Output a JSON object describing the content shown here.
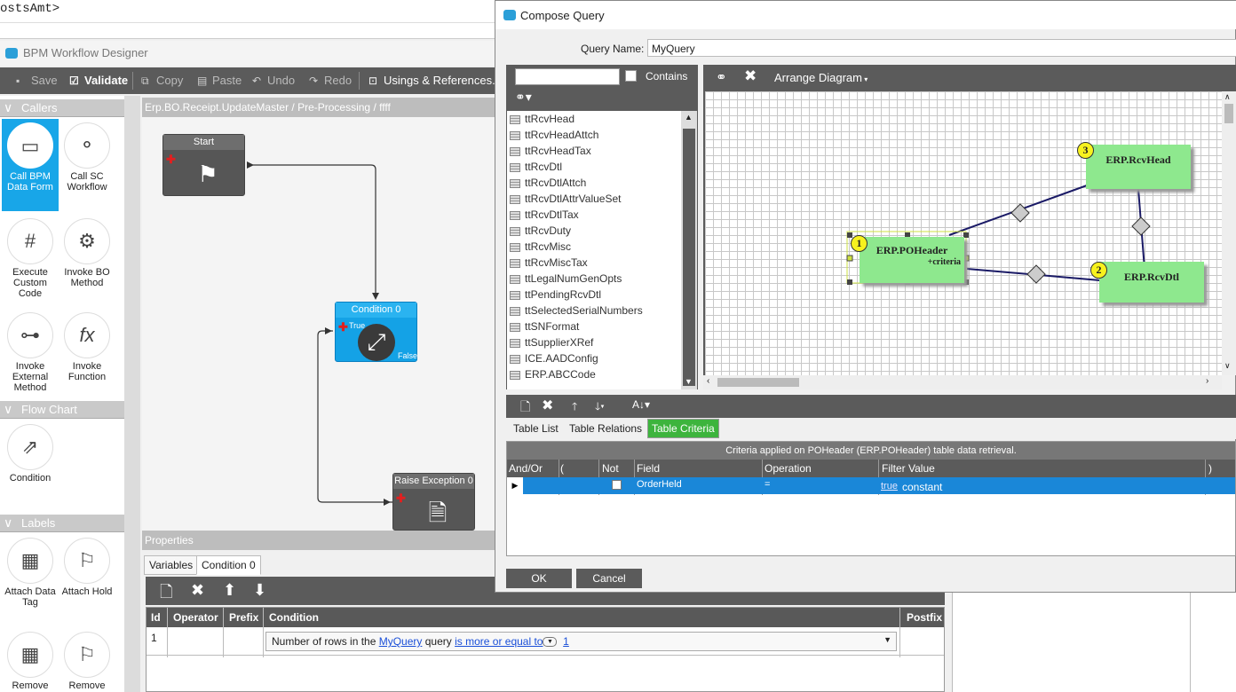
{
  "code_line": "ostsAmt>",
  "bpm": {
    "window_title": "BPM Workflow Designer",
    "toolbar": {
      "save": "Save",
      "validate": "Validate",
      "copy": "Copy",
      "paste": "Paste",
      "undo": "Undo",
      "redo": "Redo",
      "usings": "Usings & References..."
    },
    "palette": {
      "callers_header": "Callers",
      "flowchart_header": "Flow Chart",
      "labels_header": "Labels",
      "items": {
        "call_bpm": "Call BPM Data Form",
        "call_sc": "Call SC Workflow",
        "execute_code": "Execute Custom Code",
        "invoke_bo": "Invoke BO Method",
        "invoke_external": "Invoke External Method",
        "invoke_function": "Invoke Function",
        "condition": "Condition",
        "attach_data_tag": "Attach Data Tag",
        "attach_hold": "Attach Hold",
        "remove1": "Remove",
        "remove2": "Remove"
      }
    },
    "breadcrumb": "Erp.BO.Receipt.UpdateMaster / Pre-Processing / ffff",
    "nodes": {
      "start": "Start",
      "condition": "Condition 0",
      "cond_true": "True",
      "cond_false": "False",
      "raise": "Raise Exception 0"
    },
    "properties": {
      "title": "Properties",
      "tabs": [
        "Variables",
        "Condition 0"
      ],
      "columns": [
        "Id",
        "Operator",
        "Prefix",
        "Condition",
        "Postfix"
      ],
      "row": {
        "id": "1",
        "condition_pre": "Number of rows in the ",
        "condition_query": "MyQuery",
        "condition_mid": " query ",
        "condition_op": "is more or equal to",
        "condition_value": "1"
      }
    }
  },
  "dialog": {
    "title": "Compose Query",
    "query_name_label": "Query Name:",
    "query_name_value": "MyQuery",
    "contains_label": "Contains",
    "tables": [
      "ttRcvHead",
      "ttRcvHeadAttch",
      "ttRcvHeadTax",
      "ttRcvDtl",
      "ttRcvDtlAttch",
      "ttRcvDtlAttrValueSet",
      "ttRcvDtlTax",
      "ttRcvDuty",
      "ttRcvMisc",
      "ttRcvMiscTax",
      "ttLegalNumGenOpts",
      "ttPendingRcvDtl",
      "ttSelectedSerialNumbers",
      "ttSNFormat",
      "ttSupplierXRef",
      "ICE.AADConfig",
      "ERP.ABCCode"
    ],
    "arrange_label": "Arrange Diagram",
    "entities": {
      "poheader": {
        "num": "1",
        "name": "ERP.POHeader",
        "sub": "+criteria"
      },
      "rcvdtl": {
        "num": "2",
        "name": "ERP.RcvDtl"
      },
      "rcvhead": {
        "num": "3",
        "name": "ERP.RcvHead"
      }
    },
    "tabs": [
      "Table List",
      "Table Relations",
      "Table Criteria"
    ],
    "criteria": {
      "caption": "Criteria applied on POHeader (ERP.POHeader)  table data retrieval.",
      "columns": [
        "And/Or",
        "(",
        "Not",
        "Field",
        "Operation",
        "Filter Value",
        ")"
      ],
      "row": {
        "field": "OrderHeld",
        "operation": "=",
        "value_link": "true",
        "value_type": "constant"
      }
    },
    "ok": "OK",
    "cancel": "Cancel"
  }
}
